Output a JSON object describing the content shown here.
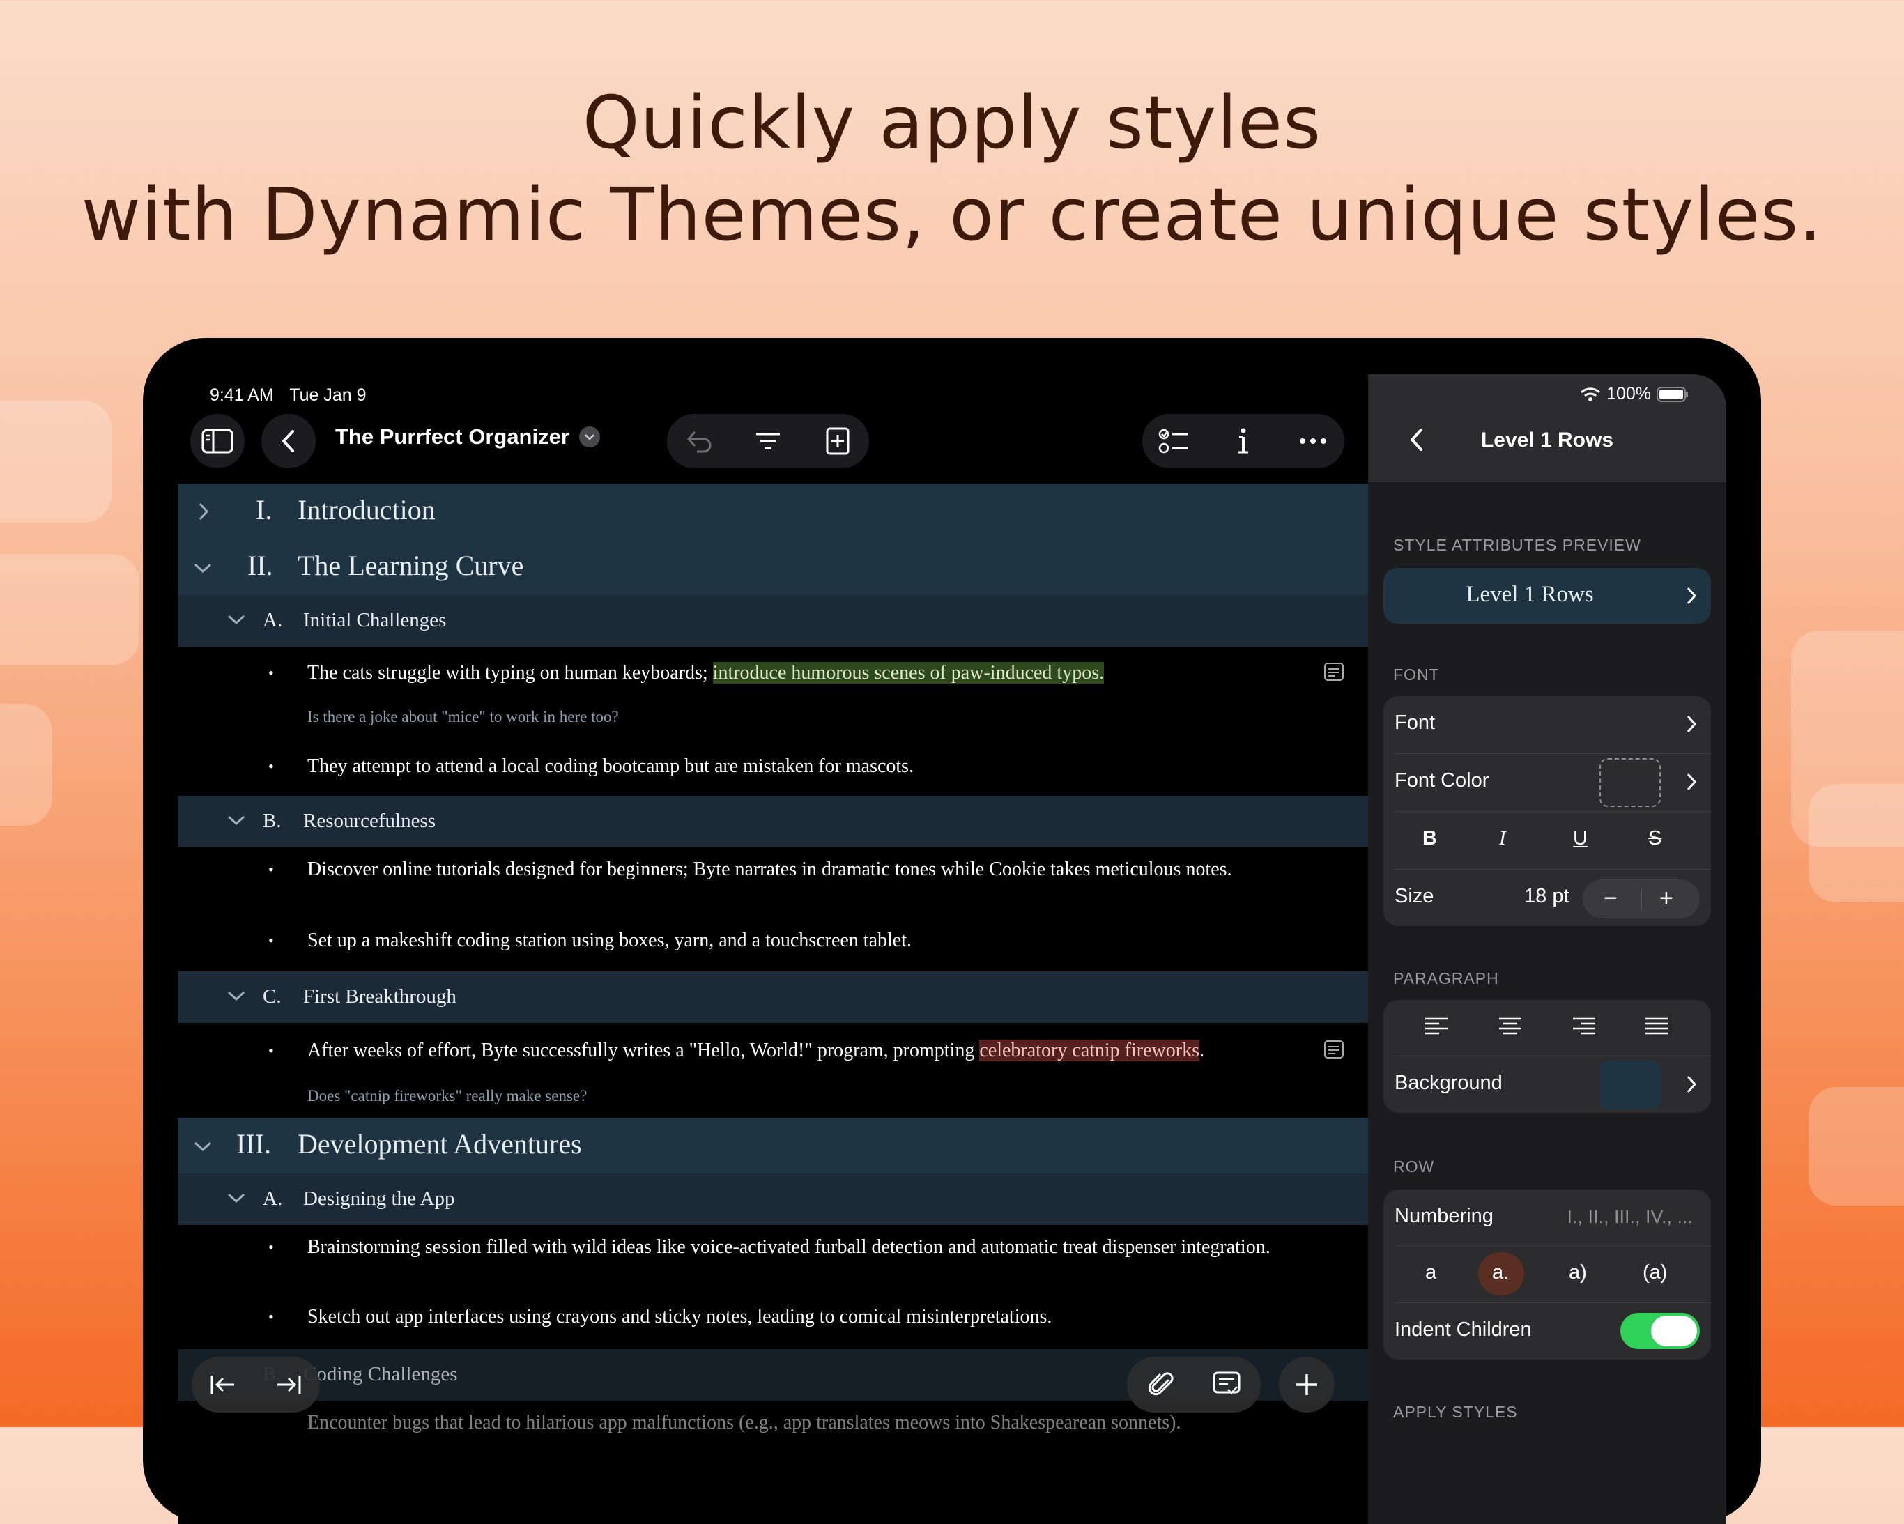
{
  "headline": {
    "line1": "Quickly apply styles",
    "line2": "with Dynamic Themes, or create unique styles."
  },
  "status": {
    "time": "9:41 AM",
    "date": "Tue Jan 9",
    "battery": "100%"
  },
  "toolbar": {
    "title": "The Purrfect Organizer"
  },
  "outline": {
    "r1": {
      "num": "I.",
      "text": "Introduction"
    },
    "r2": {
      "num": "II.",
      "text": "The Learning Curve"
    },
    "r2a": {
      "num": "A.",
      "text": "Initial Challenges"
    },
    "b1_plain": "The cats struggle with typing on human keyboards; ",
    "b1_hl": "introduce humorous scenes of paw-induced typos.",
    "n1": "Is there a joke about \"mice\" to work in here too?",
    "b2": "They attempt to attend a local coding bootcamp but are mistaken for mascots.",
    "r2b": {
      "num": "B.",
      "text": "Resourcefulness"
    },
    "b3": "Discover online tutorials designed for beginners; Byte narrates in dramatic tones while Cookie takes meticulous notes.",
    "b4": "Set up a makeshift coding station using boxes, yarn, and a touchscreen tablet.",
    "r2c": {
      "num": "C.",
      "text": "First Breakthrough"
    },
    "b5_plain": "After weeks of effort, Byte successfully writes a \"Hello, World!\" program, prompting ",
    "b5_hl": "celebratory catnip fireworks",
    "b5_end": ".",
    "n2": "Does  \"catnip fireworks\" really make sense?",
    "r3": {
      "num": "III.",
      "text": "Development Adventures"
    },
    "r3a": {
      "num": "A.",
      "text": "Designing the App"
    },
    "b6": "Brainstorming session filled with wild ideas like voice-activated furball detection and automatic treat dispenser integration.",
    "b7": "Sketch out app interfaces using crayons and sticky notes, leading to comical misinterpretations.",
    "r3b": {
      "num": "B.",
      "text": "Coding Challenges"
    },
    "b8": "Encounter bugs that lead to hilarious app malfunctions (e.g., app translates meows into Shakespearean sonnets)."
  },
  "sidebar": {
    "title": "Level 1 Rows",
    "preview_label": "STYLE ATTRIBUTES PREVIEW",
    "preview_value": "Level 1 Rows",
    "font_label": "FONT",
    "font": "Font",
    "font_color": "Font Color",
    "size_label": "Size",
    "size_value": "18 pt",
    "paragraph_label": "PARAGRAPH",
    "background": "Background",
    "background_color": "#1f3443",
    "row_label": "ROW",
    "numbering": "Numbering",
    "numbering_value": "I., II., III., IV., ...",
    "num_opts": [
      "a",
      "a.",
      "a)",
      "(a)"
    ],
    "indent_children": "Indent Children",
    "indent_on": true,
    "apply_label": "APPLY STYLES"
  },
  "colors": {
    "accent_toggle": "#30d158",
    "selected_chip": "#5a2e22"
  }
}
